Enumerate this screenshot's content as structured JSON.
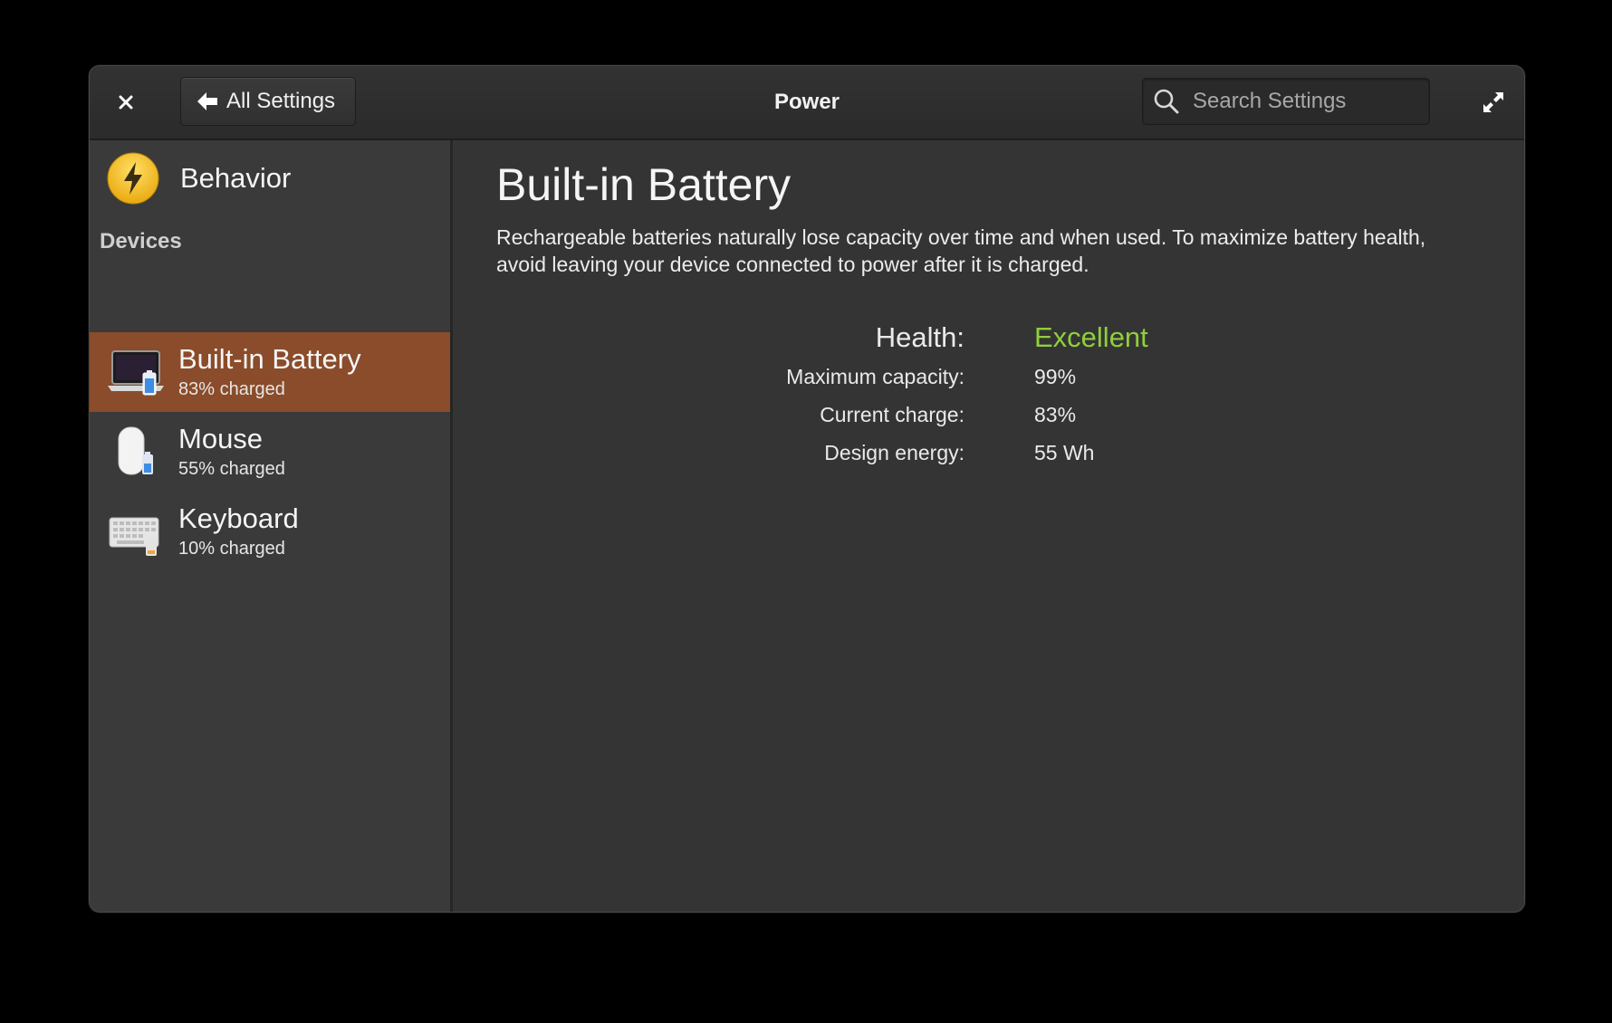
{
  "window": {
    "title": "Power"
  },
  "header": {
    "close_icon": "close-icon",
    "back_label": "All Settings",
    "back_icon": "left-arrow-icon",
    "search_placeholder": "Search Settings",
    "search_value": "",
    "expand_icon": "fullscreen-icon"
  },
  "sidebar": {
    "behavior": {
      "label": "Behavior",
      "icon": "lightning-bolt-icon"
    },
    "devices_header": "Devices",
    "devices": [
      {
        "name": "Built-in Battery",
        "status": "83% charged",
        "icon": "laptop-battery-icon",
        "charge": 83,
        "selected": true
      },
      {
        "name": "Mouse",
        "status": "55% charged",
        "icon": "mouse-battery-icon",
        "charge": 55,
        "selected": false
      },
      {
        "name": "Keyboard",
        "status": "10% charged",
        "icon": "keyboard-battery-icon",
        "charge": 10,
        "selected": false
      }
    ]
  },
  "main": {
    "heading": "Built-in Battery",
    "description": "Rechargeable batteries naturally lose capacity over time and when used. To maximize battery health, avoid leaving your device connected to power after it is charged.",
    "stats": [
      {
        "label": "Health:",
        "value": "Excellent"
      },
      {
        "label": "Maximum capacity:",
        "value": "99%"
      },
      {
        "label": "Current charge:",
        "value": "83%"
      },
      {
        "label": "Design energy:",
        "value": "55 Wh"
      }
    ]
  },
  "colors": {
    "selected_row": "#8a4c2a",
    "health_excellent": "#8fcf3c",
    "battery_blue": "#3f8de0",
    "battery_low_orange": "#f2a33a",
    "behavior_yellow": "#f4c21b"
  }
}
